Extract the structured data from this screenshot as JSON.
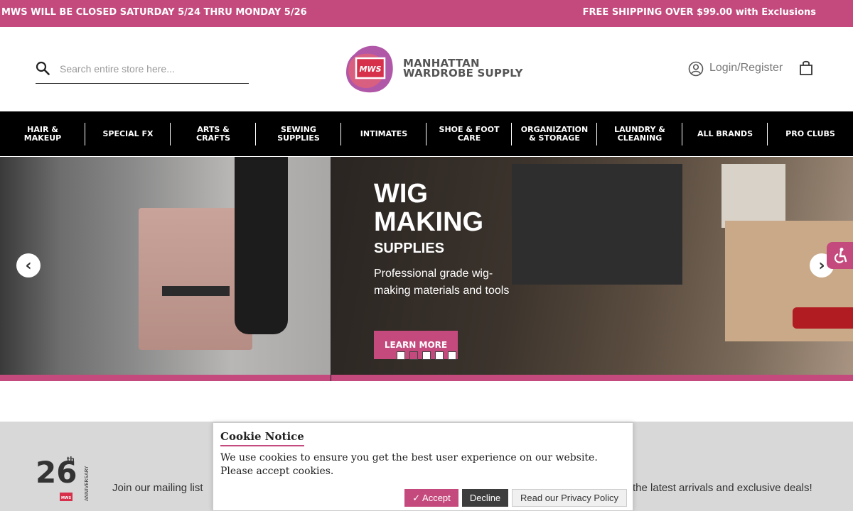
{
  "announcement": {
    "left": "MWS WILL BE CLOSED SATURDAY 5/24 THRU MONDAY 5/26",
    "right": "FREE SHIPPING OVER $99.00 with Exclusions"
  },
  "header": {
    "search_placeholder": "Search entire store here...",
    "logo_mark": "MWS",
    "logo_line1": "MANHATTAN",
    "logo_line2": "WARDROBE SUPPLY",
    "account_label": "Login/Register"
  },
  "nav": {
    "items": [
      {
        "label": "HAIR &\nMAKEUP"
      },
      {
        "label": "SPECIAL FX"
      },
      {
        "label": "ARTS &\nCRAFTS"
      },
      {
        "label": "SEWING\nSUPPLIES"
      },
      {
        "label": "INTIMATES"
      },
      {
        "label": "SHOE & FOOT\nCARE"
      },
      {
        "label": "ORGANIZATION\n& STORAGE"
      },
      {
        "label": "LAUNDRY &\nCLEANING"
      },
      {
        "label": "ALL BRANDS"
      },
      {
        "label": "PRO CLUBS"
      }
    ]
  },
  "hero": {
    "heading": "WIG\nMAKING",
    "subheading": "SUPPLIES",
    "description": "Professional grade wig-making materials and tools",
    "cta": "LEARN MORE",
    "slide_count": 5,
    "active_slide": 2,
    "prev_glyph": "‹",
    "next_glyph": "›"
  },
  "newsletter": {
    "left_text": "Join our mailing list",
    "right_text": "the latest arrivals and exclusive deals!",
    "badge_number": "26",
    "badge_suffix": "th",
    "badge_caption": "ANNIVERSARY",
    "badge_mark": "MWS"
  },
  "cookie": {
    "title": "Cookie Notice",
    "message_line1": "We use cookies to ensure you get the best user experience on our website.",
    "message_line2": "Please accept cookies.",
    "accept": "✓ Accept",
    "decline": "Decline",
    "privacy": "Read our Privacy Policy"
  },
  "colors": {
    "brand": "#c44a7d",
    "nav_bg": "#000000",
    "newsletter_bg": "#d8d8d8"
  },
  "icons": [
    "search-icon",
    "user-icon",
    "cart-icon",
    "accessibility-icon",
    "chevron-left-icon",
    "chevron-right-icon"
  ]
}
